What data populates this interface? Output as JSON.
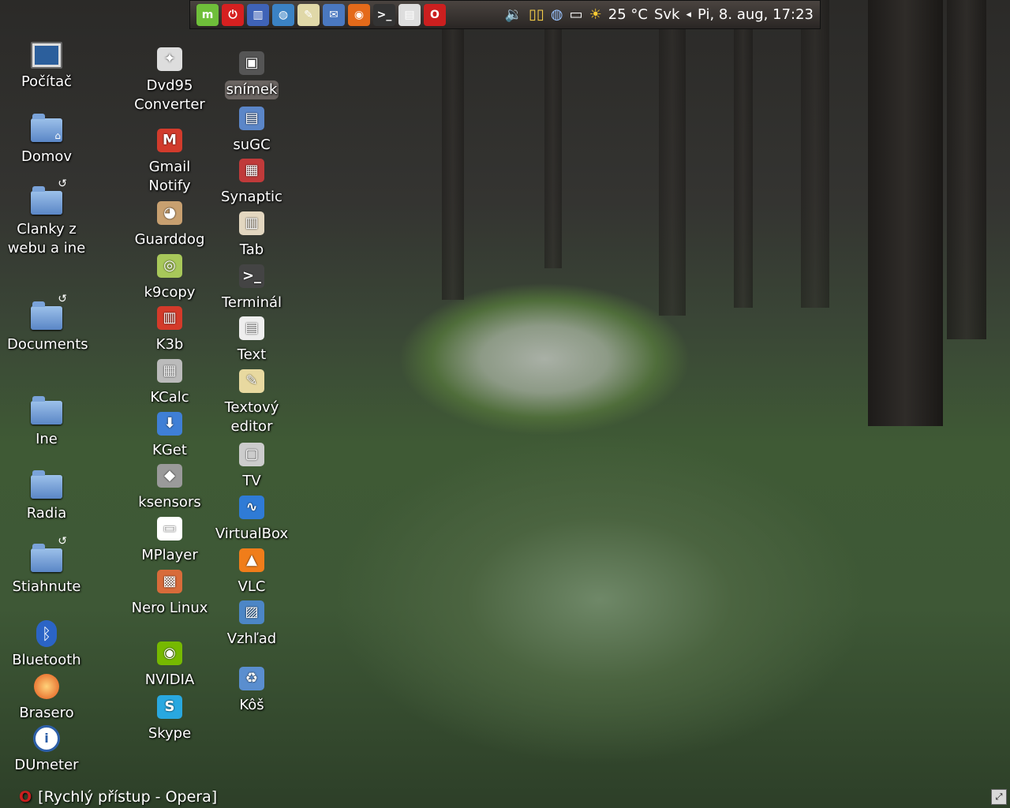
{
  "panel": {
    "launchers": [
      {
        "icon": "mint-menu-icon",
        "glyph": "m",
        "color": "#6fbf3a"
      },
      {
        "icon": "power-icon",
        "glyph": "⏻",
        "color": "#d62020"
      },
      {
        "icon": "file-manager-icon",
        "glyph": "▥",
        "color": "#3f63b8"
      },
      {
        "icon": "globe-icon",
        "glyph": "◍",
        "color": "#3b82c4"
      },
      {
        "icon": "text-editor-icon",
        "glyph": "✎",
        "color": "#e0d8a8"
      },
      {
        "icon": "thunderbird-icon",
        "glyph": "✉",
        "color": "#4a78c0"
      },
      {
        "icon": "firefox-icon",
        "glyph": "◉",
        "color": "#e46a1a"
      },
      {
        "icon": "terminal-icon",
        "glyph": ">_",
        "color": "#333333"
      },
      {
        "icon": "document-icon",
        "glyph": "▤",
        "color": "#dddddd"
      },
      {
        "icon": "opera-icon",
        "glyph": "O",
        "color": "#cc1f1f"
      }
    ],
    "tray": {
      "weather": "25 °C",
      "keyboard": "Svk",
      "clock": "Pi, 8. aug, 17:23"
    }
  },
  "desktop": {
    "col1": [
      {
        "label": "Počítač",
        "type": "computer"
      },
      {
        "label": "Domov",
        "type": "home"
      },
      {
        "label": "Clanky z webu a ine",
        "type": "folder-link"
      },
      {
        "label": "Documents",
        "type": "folder-link"
      },
      {
        "label": "Ine",
        "type": "folder"
      },
      {
        "label": "Radia",
        "type": "folder"
      },
      {
        "label": "Stiahnute",
        "type": "folder-link"
      },
      {
        "label": "Bluetooth",
        "type": "bluetooth"
      },
      {
        "label": "Brasero",
        "type": "brasero"
      },
      {
        "label": "DUmeter",
        "type": "info"
      }
    ],
    "col2": [
      {
        "label": "Dvd95 Converter",
        "glyph": "✦",
        "color": "#dddddd"
      },
      {
        "label": "Gmail Notify",
        "glyph": "M",
        "color": "#d23b2c"
      },
      {
        "label": "Guarddog",
        "glyph": "◕",
        "color": "#c8a070"
      },
      {
        "label": "k9copy",
        "glyph": "◎",
        "color": "#a8c85a"
      },
      {
        "label": "K3b",
        "glyph": "▥",
        "color": "#d43a2a"
      },
      {
        "label": "KCalc",
        "glyph": "▦",
        "color": "#bbbbbb"
      },
      {
        "label": "KGet",
        "glyph": "⬇",
        "color": "#3f7fd6"
      },
      {
        "label": "ksensors",
        "glyph": "◆",
        "color": "#9a9a9a"
      },
      {
        "label": "MPlayer",
        "glyph": "▭",
        "color": "#ffffff"
      },
      {
        "label": "Nero Linux",
        "glyph": "▩",
        "color": "#d86b3a"
      },
      {
        "label": "NVIDIA",
        "glyph": "◉",
        "color": "#76b900"
      },
      {
        "label": "Skype",
        "glyph": "S",
        "color": "#29a8e0"
      }
    ],
    "col3": [
      {
        "label": "snímek",
        "glyph": "▣",
        "color": "#555555",
        "selected": true
      },
      {
        "label": "suGC",
        "glyph": "▤",
        "color": "#5b86c8"
      },
      {
        "label": "Synaptic",
        "glyph": "▦",
        "color": "#c03a3a"
      },
      {
        "label": "Tab",
        "glyph": "▥",
        "color": "#e3d7c0"
      },
      {
        "label": "Terminál",
        "glyph": ">_",
        "color": "#444444"
      },
      {
        "label": "Text",
        "glyph": "▤",
        "color": "#eeeeee"
      },
      {
        "label": "Textový editor",
        "glyph": "✎",
        "color": "#e8d9a0"
      },
      {
        "label": "TV",
        "glyph": "▢",
        "color": "#cccccc"
      },
      {
        "label": "VirtualBox",
        "glyph": "∿",
        "color": "#2f7bd6"
      },
      {
        "label": "VLC",
        "glyph": "▲",
        "color": "#f07d1a"
      },
      {
        "label": "Vzhľad",
        "glyph": "▨",
        "color": "#4c86c6"
      },
      {
        "label": "Kôš",
        "glyph": "♻",
        "color": "#5a8ecf"
      }
    ]
  },
  "taskbar": {
    "task_title": "[Rychlý přístup - Opera]"
  }
}
